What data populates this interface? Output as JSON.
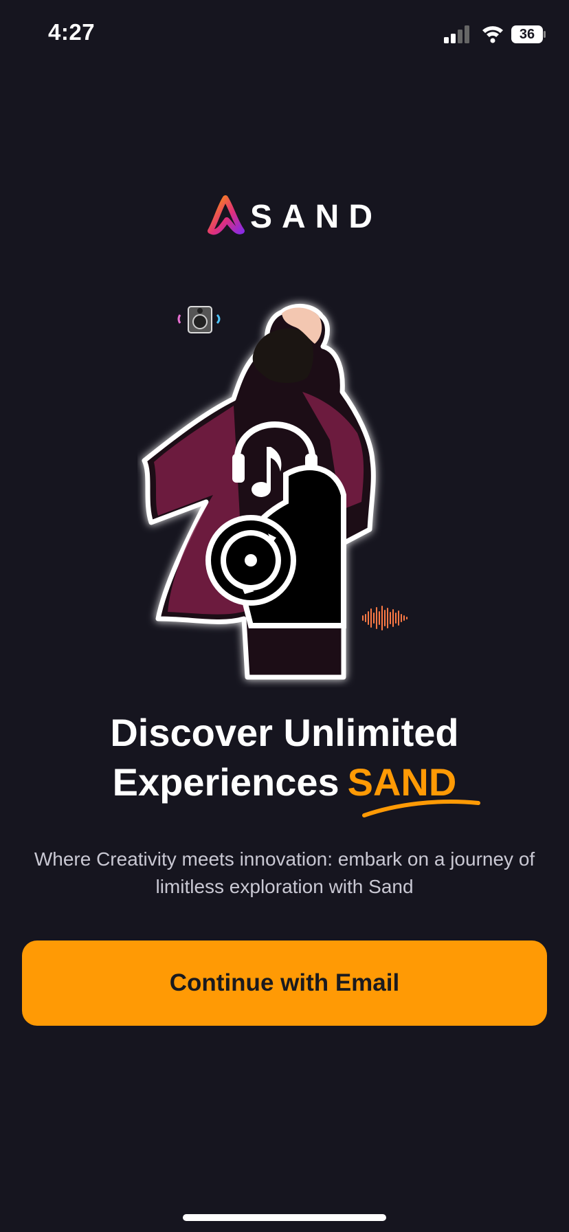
{
  "status_bar": {
    "time": "4:27",
    "battery": "36",
    "icons": [
      "cellular-signal-icon",
      "wifi-icon",
      "battery-icon"
    ]
  },
  "logo": {
    "text": "SAND"
  },
  "hero": {
    "description_icons": [
      "headphones-icon",
      "vinyl-record-icon",
      "speaker-icon",
      "waveform-icon"
    ]
  },
  "headline": {
    "line1": "Discover Unlimited",
    "line2": "Experiences",
    "accent": "SAND"
  },
  "subtitle": "Where Creativity meets innovation: embark on a journey of limitless exploration with Sand",
  "cta": {
    "label": "Continue with Email"
  },
  "colors": {
    "background": "#16151f",
    "accent": "#ff9a05",
    "text": "#ffffff",
    "subtext": "#c9c8d3"
  }
}
